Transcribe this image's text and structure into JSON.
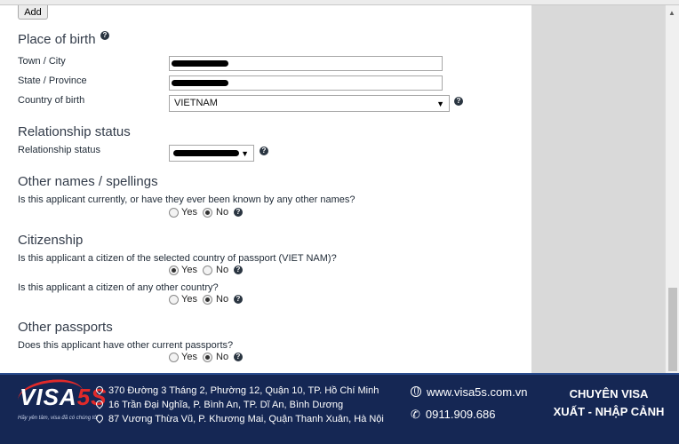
{
  "form": {
    "add_button": "Add",
    "place_of_birth": {
      "heading": "Place of birth",
      "town_label": "Town / City",
      "state_label": "State / Province",
      "country_label": "Country of birth",
      "country_value": "VIETNAM"
    },
    "relationship": {
      "heading": "Relationship status",
      "label": "Relationship status"
    },
    "other_names": {
      "heading": "Other names / spellings",
      "question": "Is this applicant currently, or have they ever been known by any other names?"
    },
    "citizenship": {
      "heading": "Citizenship",
      "question1": "Is this applicant a citizen of the selected country of passport (VIET NAM)?",
      "question2": "Is this applicant a citizen of any other country?"
    },
    "other_passports": {
      "heading": "Other passports",
      "question": "Does this applicant have other current passports?"
    },
    "yes_label": "Yes",
    "no_label": "No",
    "help_glyph": "?",
    "caret_glyph": "▼",
    "answers": {
      "other_names": "No",
      "citizen_selected": "Yes",
      "citizen_other": "No",
      "other_passports": "No"
    }
  },
  "footer": {
    "logo_main": "VISA",
    "logo_accent": "5S",
    "slogan": "Hãy yên tâm, visa đã có chúng tôi",
    "addresses": [
      "370 Đường 3 Tháng 2, Phường 12, Quận 10, TP. Hồ Chí Minh",
      "16 Trần Đại Nghĩa, P. Bình An, TP. Dĩ An, Bình Dương",
      "87 Vương Thừa Vũ, P. Khương Mai, Quận Thanh Xuân, Hà Nội"
    ],
    "website": "www.visa5s.com.vn",
    "phone": "0911.909.686",
    "tagline_line1": "CHUYÊN VISA",
    "tagline_line2": "XUẤT - NHẬP CẢNH",
    "accent_color": "#e02a2a",
    "background_color": "#152754"
  }
}
